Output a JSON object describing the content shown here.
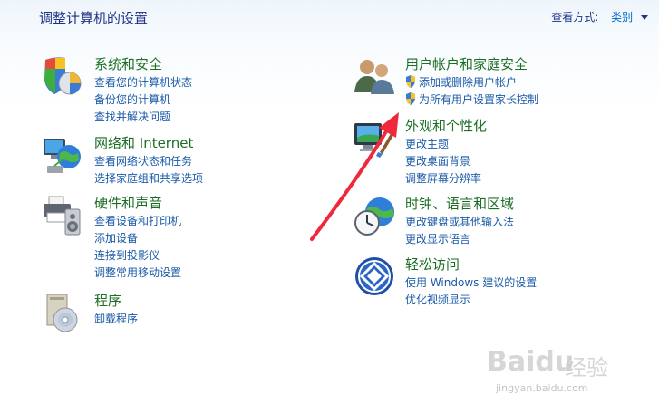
{
  "header": {
    "title": "调整计算机的设置",
    "view_by_label": "查看方式:",
    "view_by_value": "类别"
  },
  "categories": [
    {
      "title": "系统和安全",
      "icon": "shield-pie-icon",
      "links": [
        "查看您的计算机状态",
        "备份您的计算机",
        "查找并解决问题"
      ]
    },
    {
      "title": "网络和 Internet",
      "icon": "globe-network-icon",
      "links": [
        "查看网络状态和任务",
        "选择家庭组和共享选项"
      ]
    },
    {
      "title": "硬件和声音",
      "icon": "printer-speaker-icon",
      "links": [
        "查看设备和打印机",
        "添加设备",
        "连接到投影仪",
        "调整常用移动设置"
      ]
    },
    {
      "title": "程序",
      "icon": "program-disc-icon",
      "links": [
        "卸载程序"
      ]
    },
    {
      "title": "用户帐户和家庭安全",
      "icon": "users-icon",
      "links": [
        "添加或删除用户帐户",
        "为所有用户设置家长控制"
      ]
    },
    {
      "title": "外观和个性化",
      "icon": "monitor-paint-icon",
      "links": [
        "更改主题",
        "更改桌面背景",
        "调整屏幕分辨率"
      ]
    },
    {
      "title": "时钟、语言和区域",
      "icon": "clock-globe-icon",
      "links": [
        "更改键盘或其他输入法",
        "更改显示语言"
      ]
    },
    {
      "title": "轻松访问",
      "icon": "ease-of-access-icon",
      "links": [
        "使用 Windows 建议的设置",
        "优化视频显示"
      ]
    }
  ],
  "watermark": {
    "logo": "Baidu",
    "logo_cn": "经验",
    "url": "jingyan.baidu.com"
  },
  "annotation": {
    "arrow_color": "#f0283c"
  }
}
